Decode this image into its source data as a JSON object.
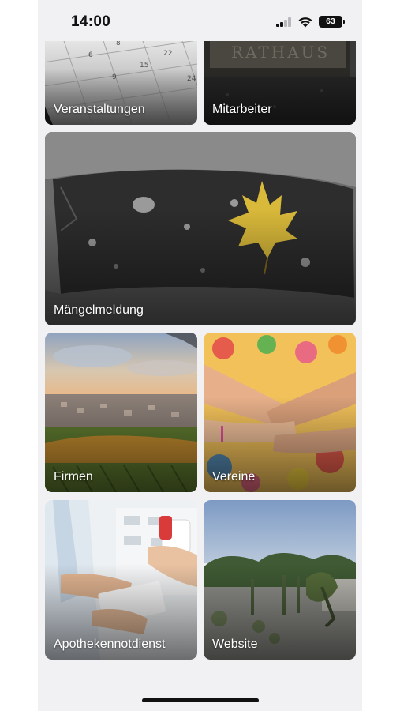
{
  "status_bar": {
    "time": "14:00",
    "battery": "63",
    "signal_bars": 2,
    "signal_bars_total": 4
  },
  "tiles": [
    {
      "label": "Veranstaltungen",
      "image": "calendar-photo",
      "color": "#d8d8d8"
    },
    {
      "label": "Mitarbeiter",
      "image": "town-hall-sign-photo",
      "color": "#2e2e2e"
    },
    {
      "label": "Mängelmeldung",
      "image": "pothole-leaf-photo",
      "color": "#4a4a4a"
    },
    {
      "label": "Firmen",
      "image": "town-vineyard-photo",
      "color": "#6f8a3c"
    },
    {
      "label": "Vereine",
      "image": "stacked-hands-photo",
      "color": "#e7b08a"
    },
    {
      "label": "Apothekennotdienst",
      "image": "pharmacy-photo",
      "color": "#dfe6ec"
    },
    {
      "label": "Website",
      "image": "sculpture-park-photo",
      "color": "#6f8a6a"
    }
  ],
  "colors": {
    "background": "#f1f1f3",
    "label_text": "#ffffff"
  }
}
